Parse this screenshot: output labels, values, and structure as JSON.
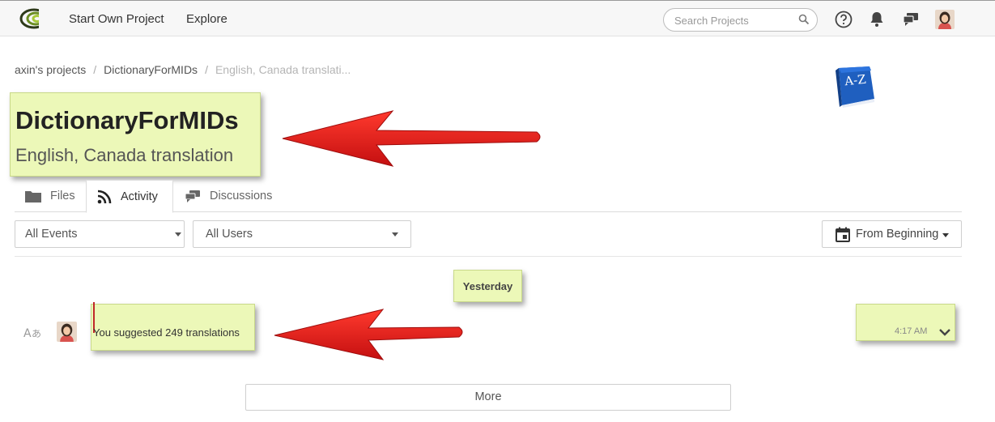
{
  "nav": {
    "start_project": "Start Own Project",
    "explore": "Explore",
    "search_placeholder": "Search Projects"
  },
  "breadcrumb": {
    "items": [
      "axin's projects",
      "DictionaryForMIDs",
      "English, Canada translati..."
    ]
  },
  "project": {
    "title": "DictionaryForMIDs",
    "subtitle": "English, Canada translation",
    "logo_text": "A-Z"
  },
  "tabs": [
    {
      "label": "Files",
      "icon": "folder-icon",
      "active": false
    },
    {
      "label": "Activity",
      "icon": "rss-icon",
      "active": true
    },
    {
      "label": "Discussions",
      "icon": "discussion-icon",
      "active": false
    }
  ],
  "filters": {
    "events": "All Events",
    "users": "All Users",
    "date_range": "From Beginning"
  },
  "activity": {
    "date_group": "Yesterday",
    "entries": [
      {
        "text": "You suggested 249 translations",
        "time": "4:17 AM",
        "icon": "translate-icon"
      }
    ],
    "more_label": "More"
  },
  "colors": {
    "highlight": "#ecf8b8",
    "annotation_arrow": "#e8191a"
  }
}
